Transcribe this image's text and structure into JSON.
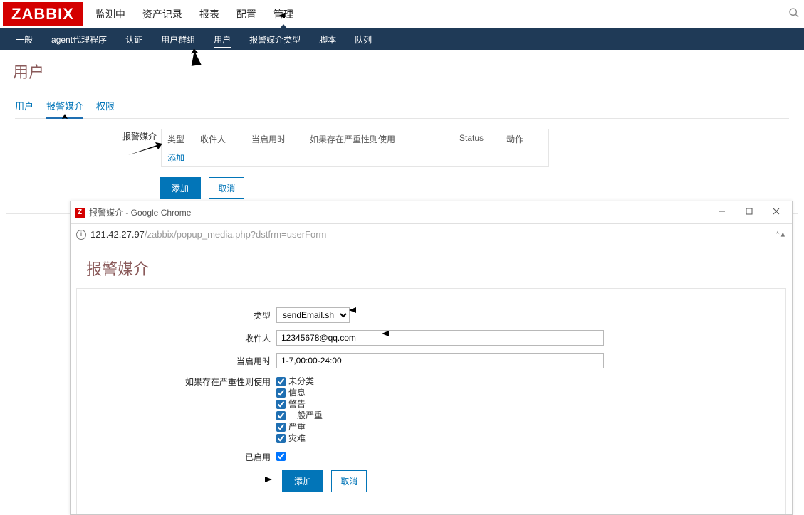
{
  "logo": "ZABBIX",
  "topnav": {
    "items": [
      "监测中",
      "资产记录",
      "报表",
      "配置",
      "管理"
    ],
    "active": "管理"
  },
  "subnav": {
    "items": [
      "一般",
      "agent代理程序",
      "认证",
      "用户群组",
      "用户",
      "报警媒介类型",
      "脚本",
      "队列"
    ],
    "active": "用户"
  },
  "page_title": "用户",
  "tabs": {
    "items": [
      "用户",
      "报警媒介",
      "权限"
    ],
    "active": "报警媒介"
  },
  "media": {
    "label": "报警媒介",
    "headers": [
      "类型",
      "收件人",
      "当启用时",
      "如果存在严重性则使用",
      "Status",
      "动作"
    ],
    "add_link": "添加"
  },
  "buttons": {
    "add": "添加",
    "cancel": "取消"
  },
  "popup": {
    "window_title": "报警媒介 - Google Chrome",
    "url_host": "121.42.27.97",
    "url_path": "/zabbix/popup_media.php?dstfrm=userForm",
    "heading": "报警媒介",
    "form": {
      "type_label": "类型",
      "type_value": "sendEmail.sh",
      "recipient_label": "收件人",
      "recipient_value": "12345678@qq.com",
      "when_label": "当启用时",
      "when_value": "1-7,00:00-24:00",
      "severity_label": "如果存在严重性则使用",
      "severities": [
        "未分类",
        "信息",
        "警告",
        "一般严重",
        "严重",
        "灾难"
      ],
      "enabled_label": "已启用",
      "add_btn": "添加",
      "cancel_btn": "取消"
    }
  }
}
